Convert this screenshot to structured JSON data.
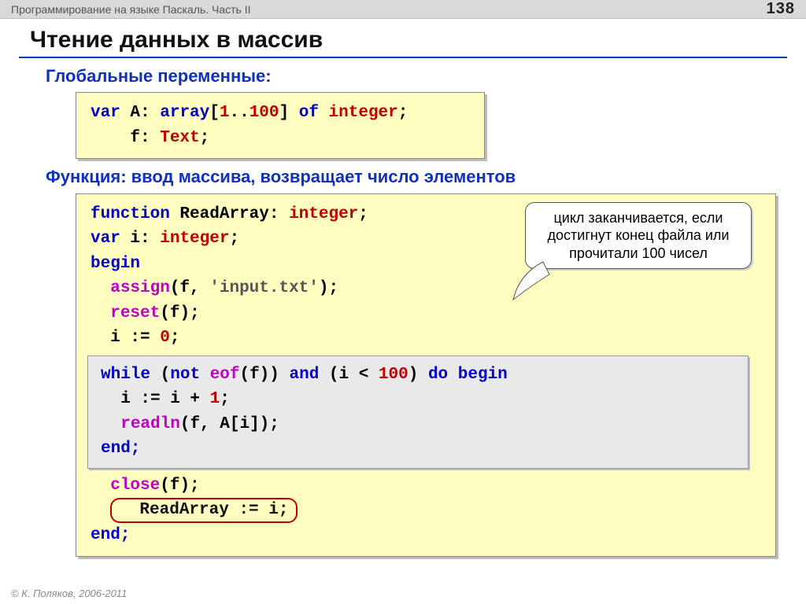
{
  "topbar": {
    "left": "Программирование на языке Паскаль. Часть II",
    "page": "138"
  },
  "title": "Чтение данных в массив",
  "sub1": "Глобальные переменные:",
  "code1": {
    "l1": {
      "a": "var",
      "b": " A: ",
      "c": "array",
      "d": "[",
      "n1": "1",
      "e": "..",
      "n2": "100",
      "f": "] ",
      "g": "of",
      "h": " ",
      "t": "integer",
      "i": ";"
    },
    "l2": {
      "a": "    f: ",
      "t": "Text",
      "b": ";"
    }
  },
  "sub2": "Функция: ввод массива, возвращает число элементов",
  "callout": "цикл заканчивается, если достигнут конец файла или прочитали 100 чисел",
  "code2": {
    "l1": {
      "a": "function",
      "b": " ReadArray: ",
      "t": "integer",
      "c": ";"
    },
    "l2": {
      "a": "var",
      "b": " i: ",
      "t": "integer",
      "c": ";"
    },
    "l3": "begin",
    "l4": {
      "a": "  ",
      "fn": "assign",
      "b": "(f, ",
      "s": "'input.txt'",
      "c": ");"
    },
    "l5": {
      "a": "  ",
      "fn": "reset",
      "b": "(f);"
    },
    "l6": {
      "a": "  i := ",
      "n": "0",
      "b": ";"
    },
    "w1": {
      "a": "while",
      "b": " (",
      "c": "not",
      "d": " ",
      "eof": "eof",
      "e": "(f)) ",
      "f": "and",
      "g": " (i < ",
      "n": "100",
      "h": ") ",
      "i": "do begin"
    },
    "w2": {
      "a": "  i := i + ",
      "n": "1",
      "b": ";"
    },
    "w3": {
      "a": "  ",
      "fn": "readln",
      "b": "(f, A[i]);"
    },
    "w4": "end;",
    "l7": {
      "a": "  ",
      "fn": "close",
      "b": "(f);"
    },
    "l8": "  ReadArray := i;",
    "l9": "end;"
  },
  "footer": "© К. Поляков, 2006-2011"
}
